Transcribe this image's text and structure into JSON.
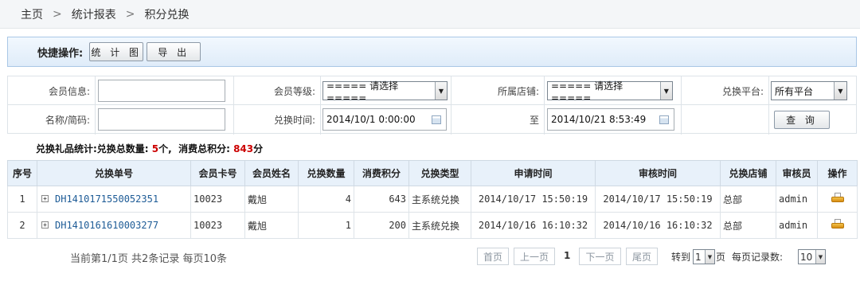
{
  "breadcrumb": {
    "home": "主页",
    "section": "统计报表",
    "page": "积分兑换",
    "separator": ">"
  },
  "quick_ops": {
    "label": "快捷操作:",
    "chart_button": "统 计 图",
    "export_button": "导 出"
  },
  "filters": {
    "member_info_label": "会员信息:",
    "member_info_value": "",
    "member_level_label": "会员等级:",
    "member_level_selected": "===== 请选择 =====",
    "store_label": "所属店铺:",
    "store_selected": "===== 请选择 =====",
    "platform_label": "兑换平台:",
    "platform_selected": "所有平台",
    "name_label": "名称/简码:",
    "name_value": "",
    "time_label": "兑换时间:",
    "time_start": "2014/10/1 0:00:00",
    "to_label": "至",
    "time_end": "2014/10/21 8:53:49",
    "query_button": "查 询"
  },
  "summary": {
    "prefix": "兑换礼品统计:兑换总数量:",
    "total_count": "5",
    "count_unit": "个,",
    "points_label": "消费总积分:",
    "total_points": "843",
    "points_unit": "分"
  },
  "table": {
    "columns": [
      "序号",
      "兑换单号",
      "会员卡号",
      "会员姓名",
      "兑换数量",
      "消费积分",
      "兑换类型",
      "申请时间",
      "审核时间",
      "兑换店铺",
      "审核员",
      "操作"
    ],
    "rows": [
      {
        "no": "1",
        "order": "DH1410171550052351",
        "card": "10023",
        "name": "戴旭",
        "qty": "4",
        "points": "643",
        "type": "主系统兑换",
        "apply_time": "2014/10/17 15:50:19",
        "audit_time": "2014/10/17 15:50:19",
        "store": "总部",
        "auditor": "admin"
      },
      {
        "no": "2",
        "order": "DH1410161610003277",
        "card": "10023",
        "name": "戴旭",
        "qty": "1",
        "points": "200",
        "type": "主系统兑换",
        "apply_time": "2014/10/16 16:10:32",
        "audit_time": "2014/10/16 16:10:32",
        "store": "总部",
        "auditor": "admin"
      }
    ]
  },
  "pager": {
    "info": "当前第1/1页 共2条记录 每页10条",
    "first": "首页",
    "prev": "上一页",
    "current": "1",
    "next": "下一页",
    "last": "尾页",
    "goto_label": "转到",
    "goto_value": "1",
    "page_unit": "页",
    "per_page_label": "每页记录数:",
    "per_page_value": "10"
  }
}
